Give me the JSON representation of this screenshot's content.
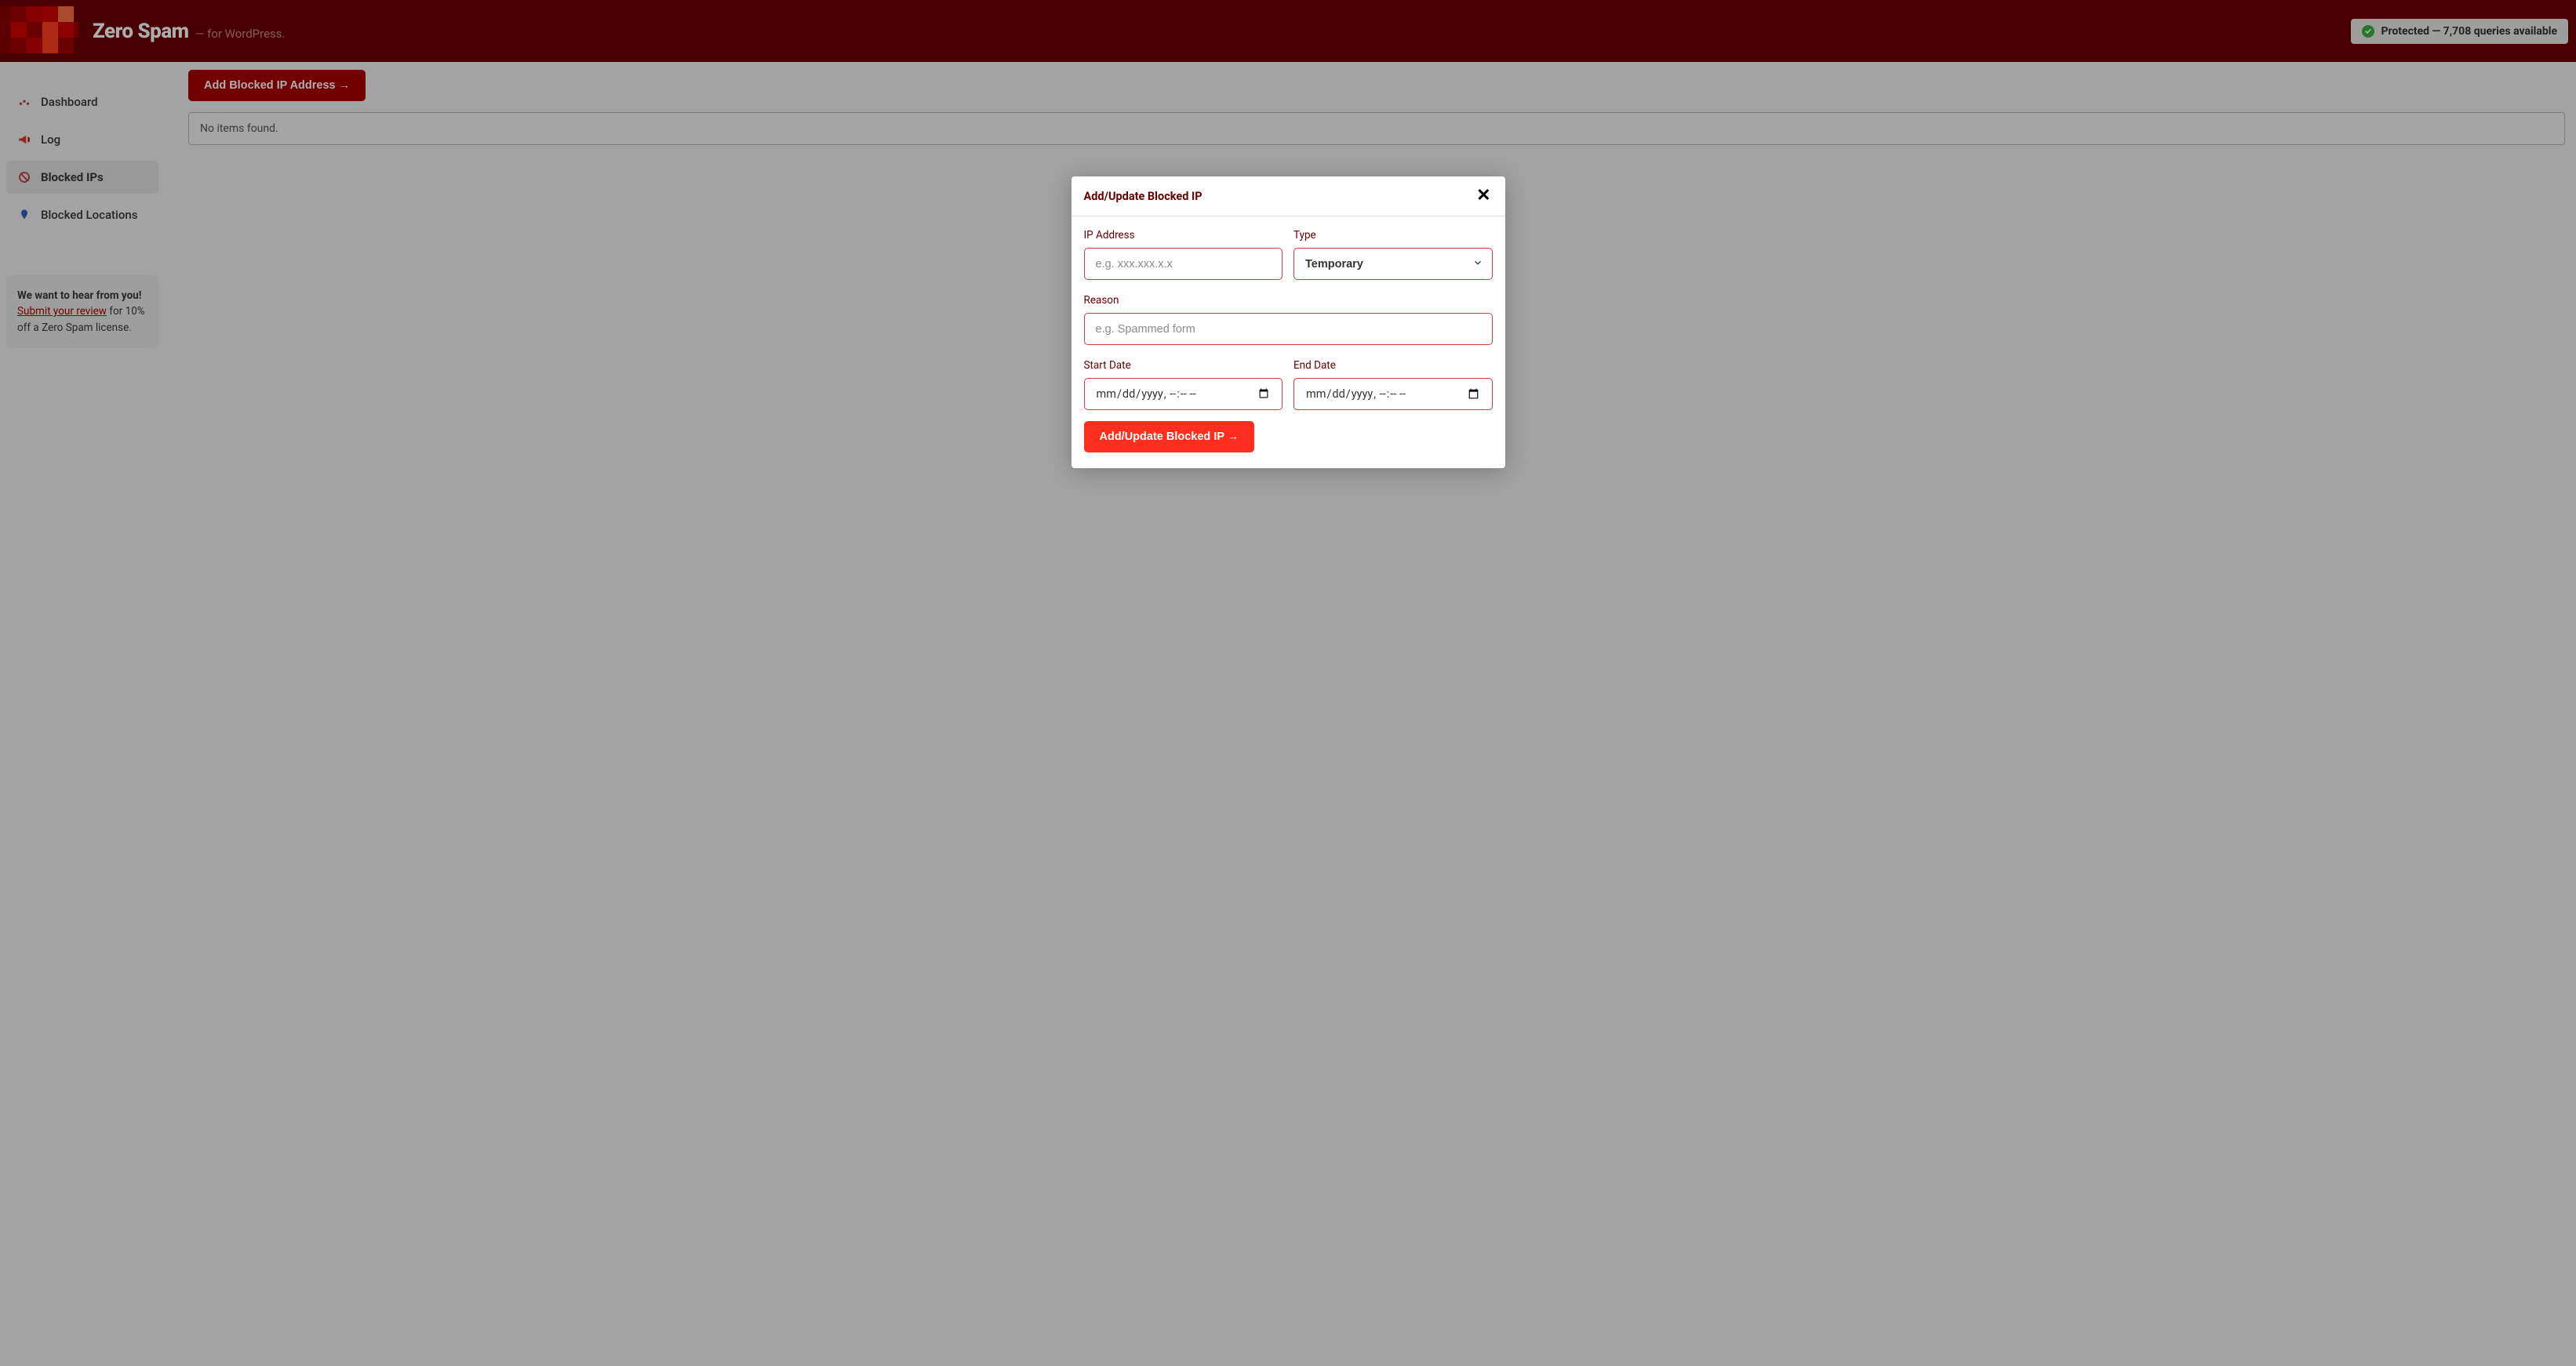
{
  "header": {
    "title": "Zero Spam",
    "subtitle": "— for WordPress.",
    "status": "Protected — 7,708 queries available"
  },
  "sidebar": {
    "items": [
      {
        "label": "Dashboard"
      },
      {
        "label": "Log"
      },
      {
        "label": "Blocked IPs"
      },
      {
        "label": "Blocked Locations"
      }
    ],
    "promo": {
      "lead": "We want to hear from you!",
      "link_text": "Submit your review",
      "rest": " for 10% off a Zero Spam license."
    }
  },
  "main": {
    "add_button": "Add Blocked IP Address →",
    "empty_notice": "No items found."
  },
  "modal": {
    "title": "Add/Update Blocked IP",
    "labels": {
      "ip": "IP Address",
      "type": "Type",
      "reason": "Reason",
      "start": "Start Date",
      "end": "End Date"
    },
    "placeholders": {
      "ip": "e.g. xxx.xxx.x.x",
      "reason": "e.g. Spammed form",
      "date": "mm/dd/yyyy, --:-- --"
    },
    "type_selected": "Temporary",
    "submit": "Add/Update Blocked IP →"
  }
}
